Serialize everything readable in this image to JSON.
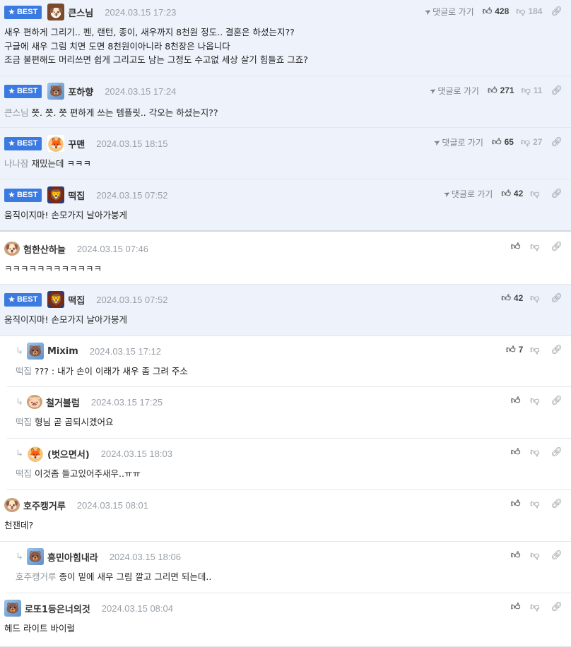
{
  "badge_label": "BEST",
  "goto_label": "댓글로 가기",
  "comments": [
    {
      "nick": "큰스님",
      "date": "2024.03.15 17:23",
      "likes": "428",
      "dislikes": "184",
      "lines": [
        "새우 편하게 그리기.. 펜, 랜턴, 종이, 새우까지 8천원 정도.. 결혼은 하셨는지??",
        "구글에 새우 그림 치면 도면 8천원이아니라 8천장은 나옵니다",
        "조금 불편해도 머리쓰면 쉽게 그리고도 남는 그정도 수고없 세상 살기 힘들죠 그죠?"
      ]
    },
    {
      "nick": "포하향",
      "date": "2024.03.15 17:24",
      "likes": "271",
      "dislikes": "11",
      "mention": "큰스님",
      "text": "쯧. 쯧. 쯧 편하게 쓰는 템플릿.. 각오는 하셨는지??"
    },
    {
      "nick": "꾸맨",
      "date": "2024.03.15 18:15",
      "likes": "65",
      "dislikes": "27",
      "mention": "나나잠",
      "text": "재밌는데 ㅋㅋㅋ"
    },
    {
      "nick": "떡집",
      "date": "2024.03.15 07:52",
      "likes": "42",
      "text": "움직이지마! 손모가지 날아가붕게"
    },
    {
      "nick": "험한산하늘",
      "date": "2024.03.15 07:46",
      "text": "ㅋㅋㅋㅋㅋㅋㅋㅋㅋㅋㅋㅋ"
    },
    {
      "nick": "떡집",
      "date": "2024.03.15 07:52",
      "likes": "42",
      "text": "움직이지마! 손모가지 날아가붕게"
    },
    {
      "nick": "Mixim",
      "date": "2024.03.15 17:12",
      "likes": "7",
      "mention": "떡집",
      "text": "??? : 내가 손이 이래가 새우 좀 그려 주소"
    },
    {
      "nick": "철거블럼",
      "date": "2024.03.15 17:25",
      "mention": "떡집",
      "text": "형님 곧 곰되시겠어요"
    },
    {
      "nick": "(벗으면서)",
      "date": "2024.03.15 18:03",
      "mention": "떡집",
      "text": "이것좀 들고있어주새우..ㅠㅠ"
    },
    {
      "nick": "호주캥거루",
      "date": "2024.03.15 08:01",
      "text": "천잰데?"
    },
    {
      "nick": "흥민아힘내라",
      "date": "2024.03.15 18:06",
      "mention": "호주캥거루",
      "text": "종이 밑에 새우 그림 깔고 그리면 되는데.."
    },
    {
      "nick": "로또1등은너의것",
      "date": "2024.03.15 08:04",
      "text": "헤드 라이트 바이럴"
    }
  ],
  "icons": {
    "like": "thumbs-up-icon",
    "dislike": "thumbs-down-icon",
    "link": "link-icon",
    "goto": "paper-plane-icon",
    "star": "star-icon",
    "reply": "reply-arrow-icon"
  },
  "colors": {
    "best_bg": "#eef3fb",
    "badge": "#3b7ae0",
    "mention": "#8e959d"
  }
}
